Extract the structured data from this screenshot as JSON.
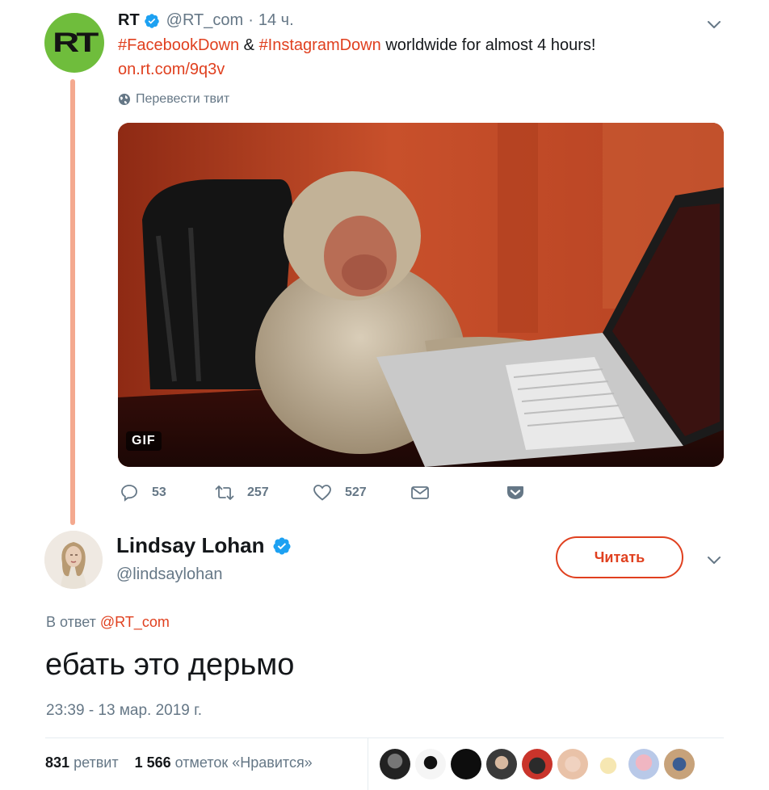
{
  "tweet1": {
    "avatar_text": "RT",
    "name": "RT",
    "handle": "@RT_com",
    "separator": "·",
    "time": "14 ч.",
    "hashtag1": "#FacebookDown",
    "amp": "&",
    "hashtag2": "#InstagramDown",
    "text_rest": "worldwide for almost 4 hours!",
    "link": "on.rt.com/9q3v",
    "translate": "Перевести твит",
    "gif_badge": "GIF",
    "actions": {
      "replies": "53",
      "retweets": "257",
      "likes": "527"
    }
  },
  "tweet2": {
    "name": "Lindsay Lohan",
    "handle": "@lindsaylohan",
    "follow_label": "Читать",
    "reply_prefix": "В ответ",
    "reply_mention": "@RT_com",
    "text": "ебать это дерьмо",
    "timestamp": "23:39 - 13 мар. 2019 г.",
    "retweets_count": "831",
    "retweets_label": "ретвит",
    "likes_count": "1 566",
    "likes_label": "отметок «Нравится»"
  },
  "icons": [
    "verified-icon",
    "chevron-down-icon",
    "globe-icon",
    "reply-icon",
    "retweet-icon",
    "heart-icon",
    "mail-icon",
    "pocket-icon"
  ],
  "colors": {
    "accent": "#e0401f",
    "thread": "#f4a98f",
    "muted": "#657786",
    "verified": "#1da1f2",
    "rt_green": "#6fbd3c"
  }
}
